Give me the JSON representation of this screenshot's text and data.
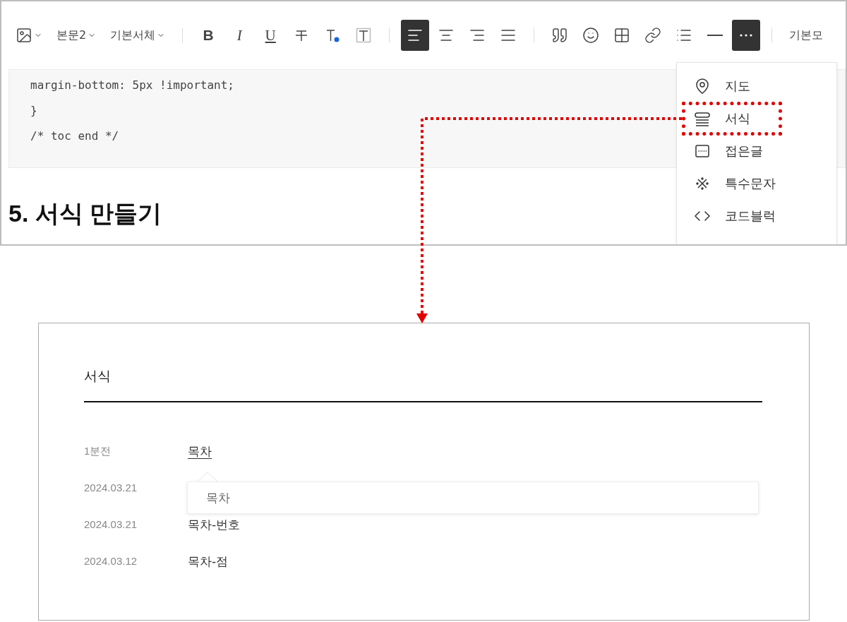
{
  "editor": {
    "toolbar": {
      "style_dropdowns": [
        {
          "label": "본문2"
        },
        {
          "label": "기본서체"
        }
      ],
      "text_buttons": [
        {
          "label": "B",
          "selected": false
        },
        {
          "label": "I",
          "selected": false
        },
        {
          "label": "U",
          "selected": false
        }
      ],
      "align_buttons": [
        {
          "selected": true
        },
        {
          "selected": false
        },
        {
          "selected": false
        },
        {
          "selected": false
        }
      ],
      "insert_buttons": [
        {
          "selected": false
        },
        {
          "selected": false
        },
        {
          "selected": false
        },
        {
          "selected": false
        },
        {
          "selected": false
        },
        {
          "selected": false
        },
        {
          "selected": true
        }
      ],
      "trailing_dropdown": {
        "label": "기본모"
      }
    },
    "code_lines": [
      "margin-bottom: 5px !important;",
      "}",
      "/* toc end */"
    ],
    "heading": "5. 서식 만들기",
    "more_menu": [
      {
        "label": "지도",
        "highlighted": false
      },
      {
        "label": "서식",
        "highlighted": true
      },
      {
        "label": "접은글",
        "highlighted": false
      },
      {
        "label": "특수문자",
        "highlighted": false
      },
      {
        "label": "코드블럭",
        "highlighted": false
      }
    ]
  },
  "templates_dialog": {
    "title": "서식",
    "rows": [
      {
        "date": "1분전",
        "title": "목차",
        "selected": true
      },
      {
        "date": "2024.03.21"
      },
      {
        "date": "2024.03.21",
        "title": "목차-번호",
        "selected": false
      },
      {
        "date": "2024.03.12",
        "title": "목차-점",
        "selected": false
      }
    ],
    "tooltip": "목차"
  }
}
